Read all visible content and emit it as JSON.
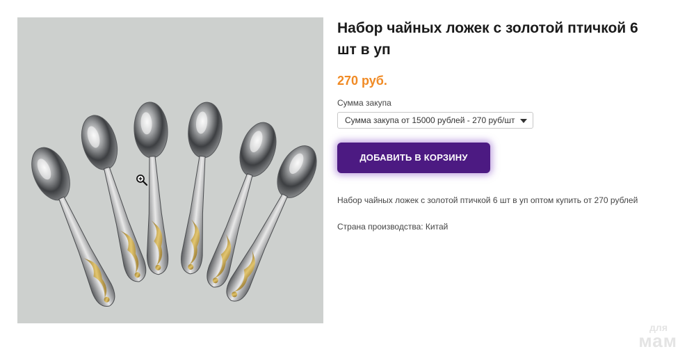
{
  "product": {
    "title": "Набор чайных ложек с золотой птичкой 6 шт в уп",
    "price": "270 руб.",
    "image_alt_icon": "zoom-in-icon"
  },
  "purchase": {
    "label": "Сумма закупа",
    "selected_option": "Сумма закупа от 15000 рублей - 270 руб/шт",
    "add_button_label": "ДОБАВИТЬ В КОРЗИНУ"
  },
  "details": {
    "description": "Набор чайных ложек с золотой птичкой 6 шт в уп оптом купить от 270 рублей",
    "country": "Страна производства: Китай"
  },
  "watermark": {
    "top": "для",
    "bottom": "мам"
  },
  "colors": {
    "price": "#f08a24",
    "button": "#4c1a82",
    "image_background": "#cdd0ce"
  }
}
